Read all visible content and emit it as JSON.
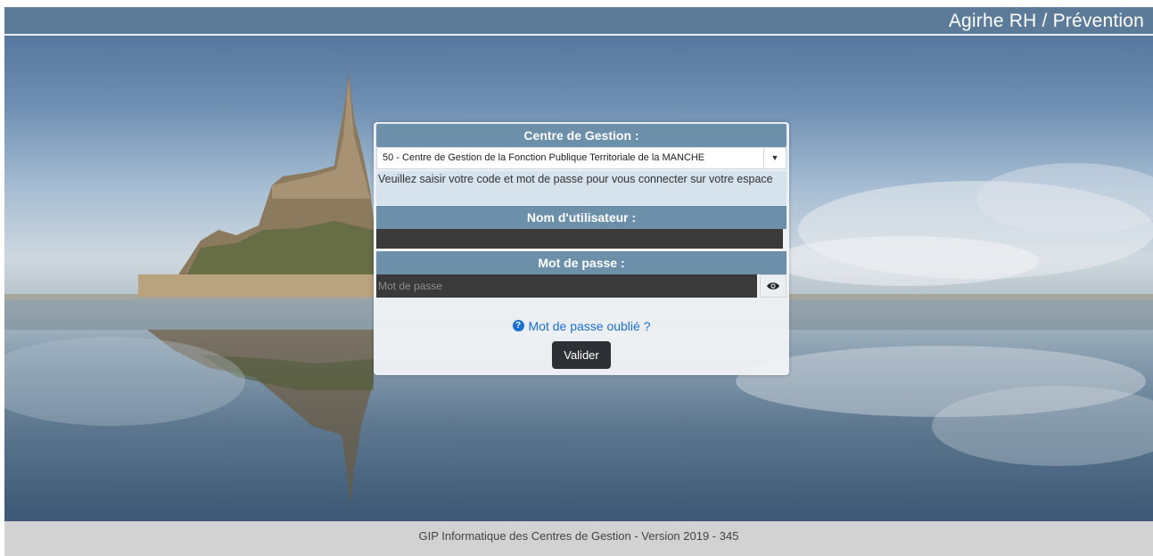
{
  "header": {
    "app_title": "Agirhe RH / Prévention"
  },
  "login": {
    "centre_label": "Centre de Gestion :",
    "centre_selected": "50 - Centre de Gestion de la Fonction Publique Territoriale de la MANCHE",
    "instructions": "Veuillez saisir votre code et mot de passe pour vous connecter sur votre espace",
    "username_label": "Nom d'utilisateur :",
    "username_value": "",
    "password_label": "Mot de passe :",
    "password_placeholder": "Mot de passe",
    "forgot_label": "Mot de passe oublié ?",
    "submit_label": "Valider"
  },
  "footer": {
    "text": "GIP Informatique des Centres de Gestion - Version 2019 - 345"
  },
  "icons": {
    "select_arrow": "chevron-down-icon",
    "show_password": "eye-icon",
    "forgot_help": "question-circle-icon"
  },
  "colors": {
    "topbar": "#5b7b98",
    "panel_header": "#6c8faa",
    "input_bg": "#3a3a3a",
    "link": "#1b6fd1",
    "button": "#2d3136",
    "footer": "#d2d2d2"
  }
}
